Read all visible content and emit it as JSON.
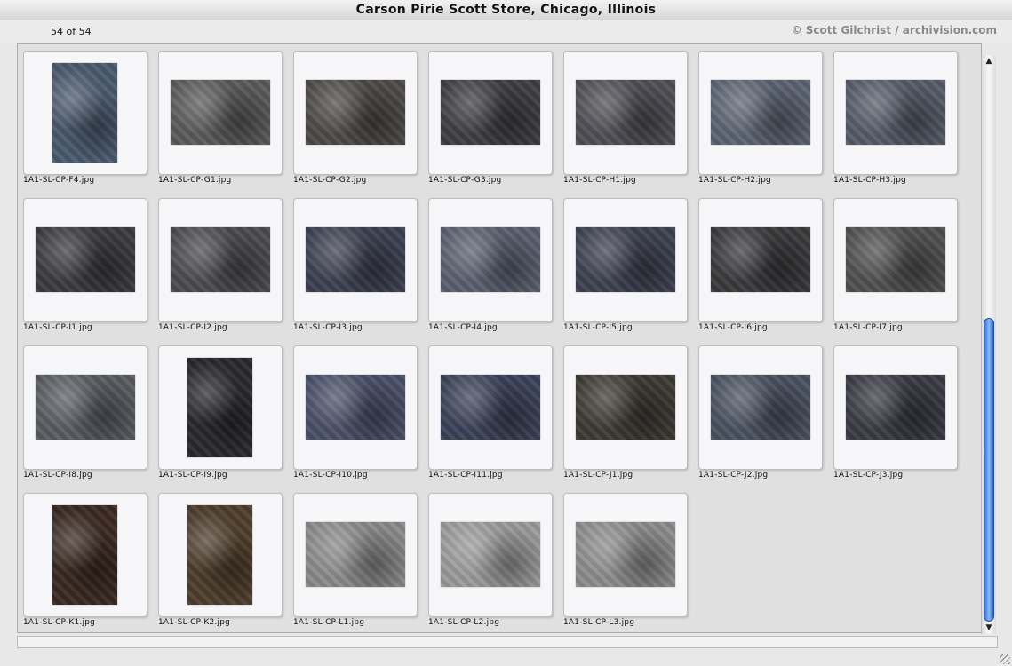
{
  "window": {
    "title": "Carson Pirie Scott Store, Chicago, Illinois"
  },
  "info": {
    "count": "54 of 54",
    "copyright": "© Scott Gilchrist / archivision.com"
  },
  "colors": {
    "scroll_thumb": "#3a7be0",
    "window_bg": "#e8e8e8"
  },
  "thumbnails": [
    {
      "label": "1A1-SL-CP-F4.jpg",
      "orientation": "portrait",
      "tone": "#4a5a6e"
    },
    {
      "label": "1A1-SL-CP-G1.jpg",
      "orientation": "landscape",
      "tone": "#5a5a5a"
    },
    {
      "label": "1A1-SL-CP-G2.jpg",
      "orientation": "landscape",
      "tone": "#4d4a46"
    },
    {
      "label": "1A1-SL-CP-G3.jpg",
      "orientation": "landscape",
      "tone": "#3f3f42"
    },
    {
      "label": "1A1-SL-CP-H1.jpg",
      "orientation": "landscape",
      "tone": "#4f4f55"
    },
    {
      "label": "1A1-SL-CP-H2.jpg",
      "orientation": "landscape",
      "tone": "#5c6472"
    },
    {
      "label": "1A1-SL-CP-H3.jpg",
      "orientation": "landscape",
      "tone": "#555c68"
    },
    {
      "label": "1A1-SL-CP-I1.jpg",
      "orientation": "landscape",
      "tone": "#3c3c40"
    },
    {
      "label": "1A1-SL-CP-I2.jpg",
      "orientation": "landscape",
      "tone": "#4c4c4e"
    },
    {
      "label": "1A1-SL-CP-I3.jpg",
      "orientation": "landscape",
      "tone": "#3d4150"
    },
    {
      "label": "1A1-SL-CP-I4.jpg",
      "orientation": "landscape",
      "tone": "#5a606e"
    },
    {
      "label": "1A1-SL-CP-I5.jpg",
      "orientation": "landscape",
      "tone": "#3e4250"
    },
    {
      "label": "1A1-SL-CP-I6.jpg",
      "orientation": "landscape",
      "tone": "#3a3a3c"
    },
    {
      "label": "1A1-SL-CP-I7.jpg",
      "orientation": "landscape",
      "tone": "#505050"
    },
    {
      "label": "1A1-SL-CP-I8.jpg",
      "orientation": "landscape",
      "tone": "#585c62"
    },
    {
      "label": "1A1-SL-CP-I9.jpg",
      "orientation": "portrait",
      "tone": "#2a2a2e"
    },
    {
      "label": "1A1-SL-CP-I10.jpg",
      "orientation": "landscape",
      "tone": "#4a5068"
    },
    {
      "label": "1A1-SL-CP-I11.jpg",
      "orientation": "landscape",
      "tone": "#3c4258"
    },
    {
      "label": "1A1-SL-CP-J1.jpg",
      "orientation": "landscape",
      "tone": "#3e3a34"
    },
    {
      "label": "1A1-SL-CP-J2.jpg",
      "orientation": "landscape",
      "tone": "#4a5260"
    },
    {
      "label": "1A1-SL-CP-J3.jpg",
      "orientation": "landscape",
      "tone": "#3a3c44"
    },
    {
      "label": "1A1-SL-CP-K1.jpg",
      "orientation": "portrait",
      "tone": "#3a2a22"
    },
    {
      "label": "1A1-SL-CP-K2.jpg",
      "orientation": "portrait",
      "tone": "#4e3e2c"
    },
    {
      "label": "1A1-SL-CP-L1.jpg",
      "orientation": "landscape",
      "tone": "#8a8a8a"
    },
    {
      "label": "1A1-SL-CP-L2.jpg",
      "orientation": "landscape",
      "tone": "#9a9a9a"
    },
    {
      "label": "1A1-SL-CP-L3.jpg",
      "orientation": "landscape",
      "tone": "#8c8c8c"
    }
  ]
}
